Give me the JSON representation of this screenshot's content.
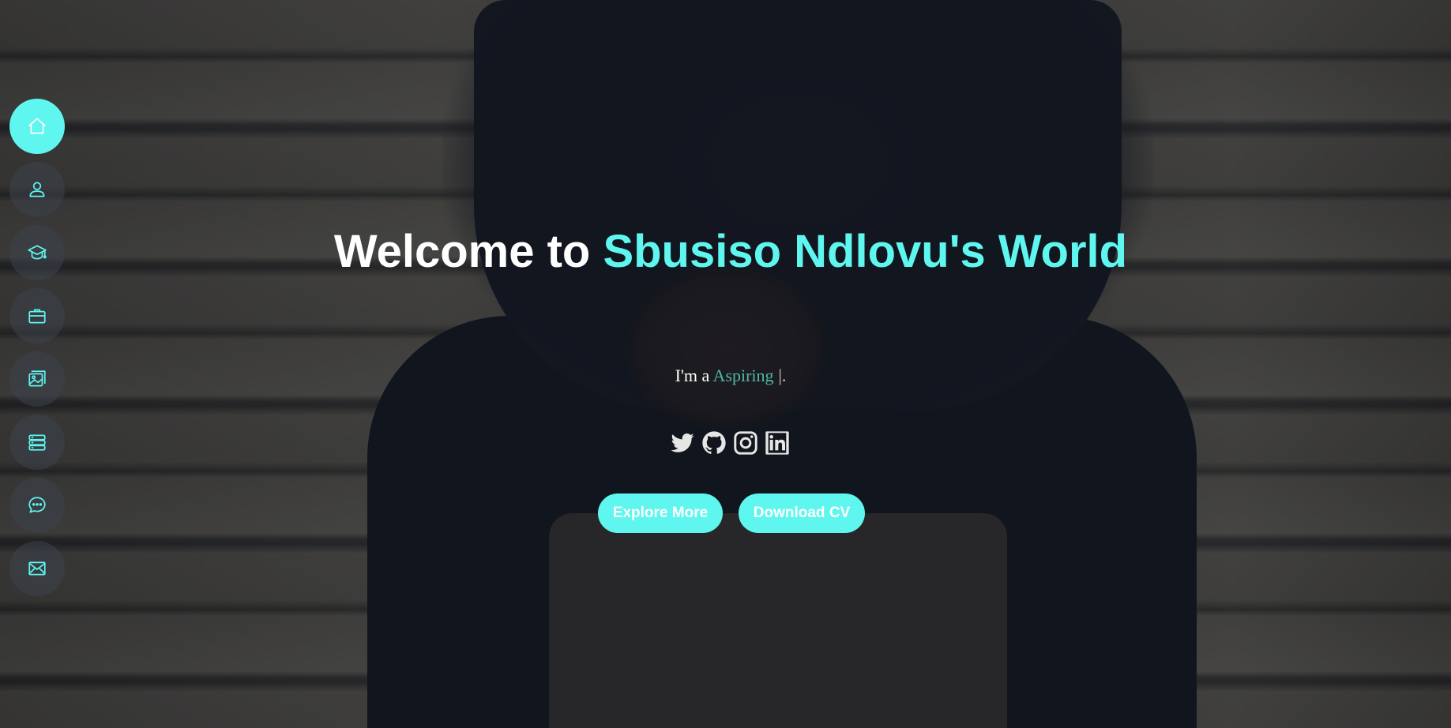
{
  "nav": {
    "items": [
      {
        "icon": "home-icon",
        "active": true
      },
      {
        "icon": "user-icon",
        "active": false
      },
      {
        "icon": "graduation-cap-icon",
        "active": false
      },
      {
        "icon": "briefcase-icon",
        "active": false
      },
      {
        "icon": "images-icon",
        "active": false
      },
      {
        "icon": "server-icon",
        "active": false
      },
      {
        "icon": "chat-icon",
        "active": false
      },
      {
        "icon": "envelope-icon",
        "active": false
      }
    ]
  },
  "hero": {
    "title_prefix": "Welcome to ",
    "title_accent": "Sbusiso Ndlovu's World",
    "tagline_prefix": "I'm a ",
    "tagline_role": "Aspiring",
    "tagline_cursor": "|."
  },
  "socials": [
    {
      "icon": "twitter-icon"
    },
    {
      "icon": "github-icon"
    },
    {
      "icon": "instagram-icon"
    },
    {
      "icon": "linkedin-icon"
    }
  ],
  "buttons": {
    "explore_label": "Explore More",
    "cv_label": "Download CV"
  },
  "colors": {
    "accent": "#5ef6ef",
    "role_text": "#4fb8a8",
    "overlay": "#141820"
  }
}
